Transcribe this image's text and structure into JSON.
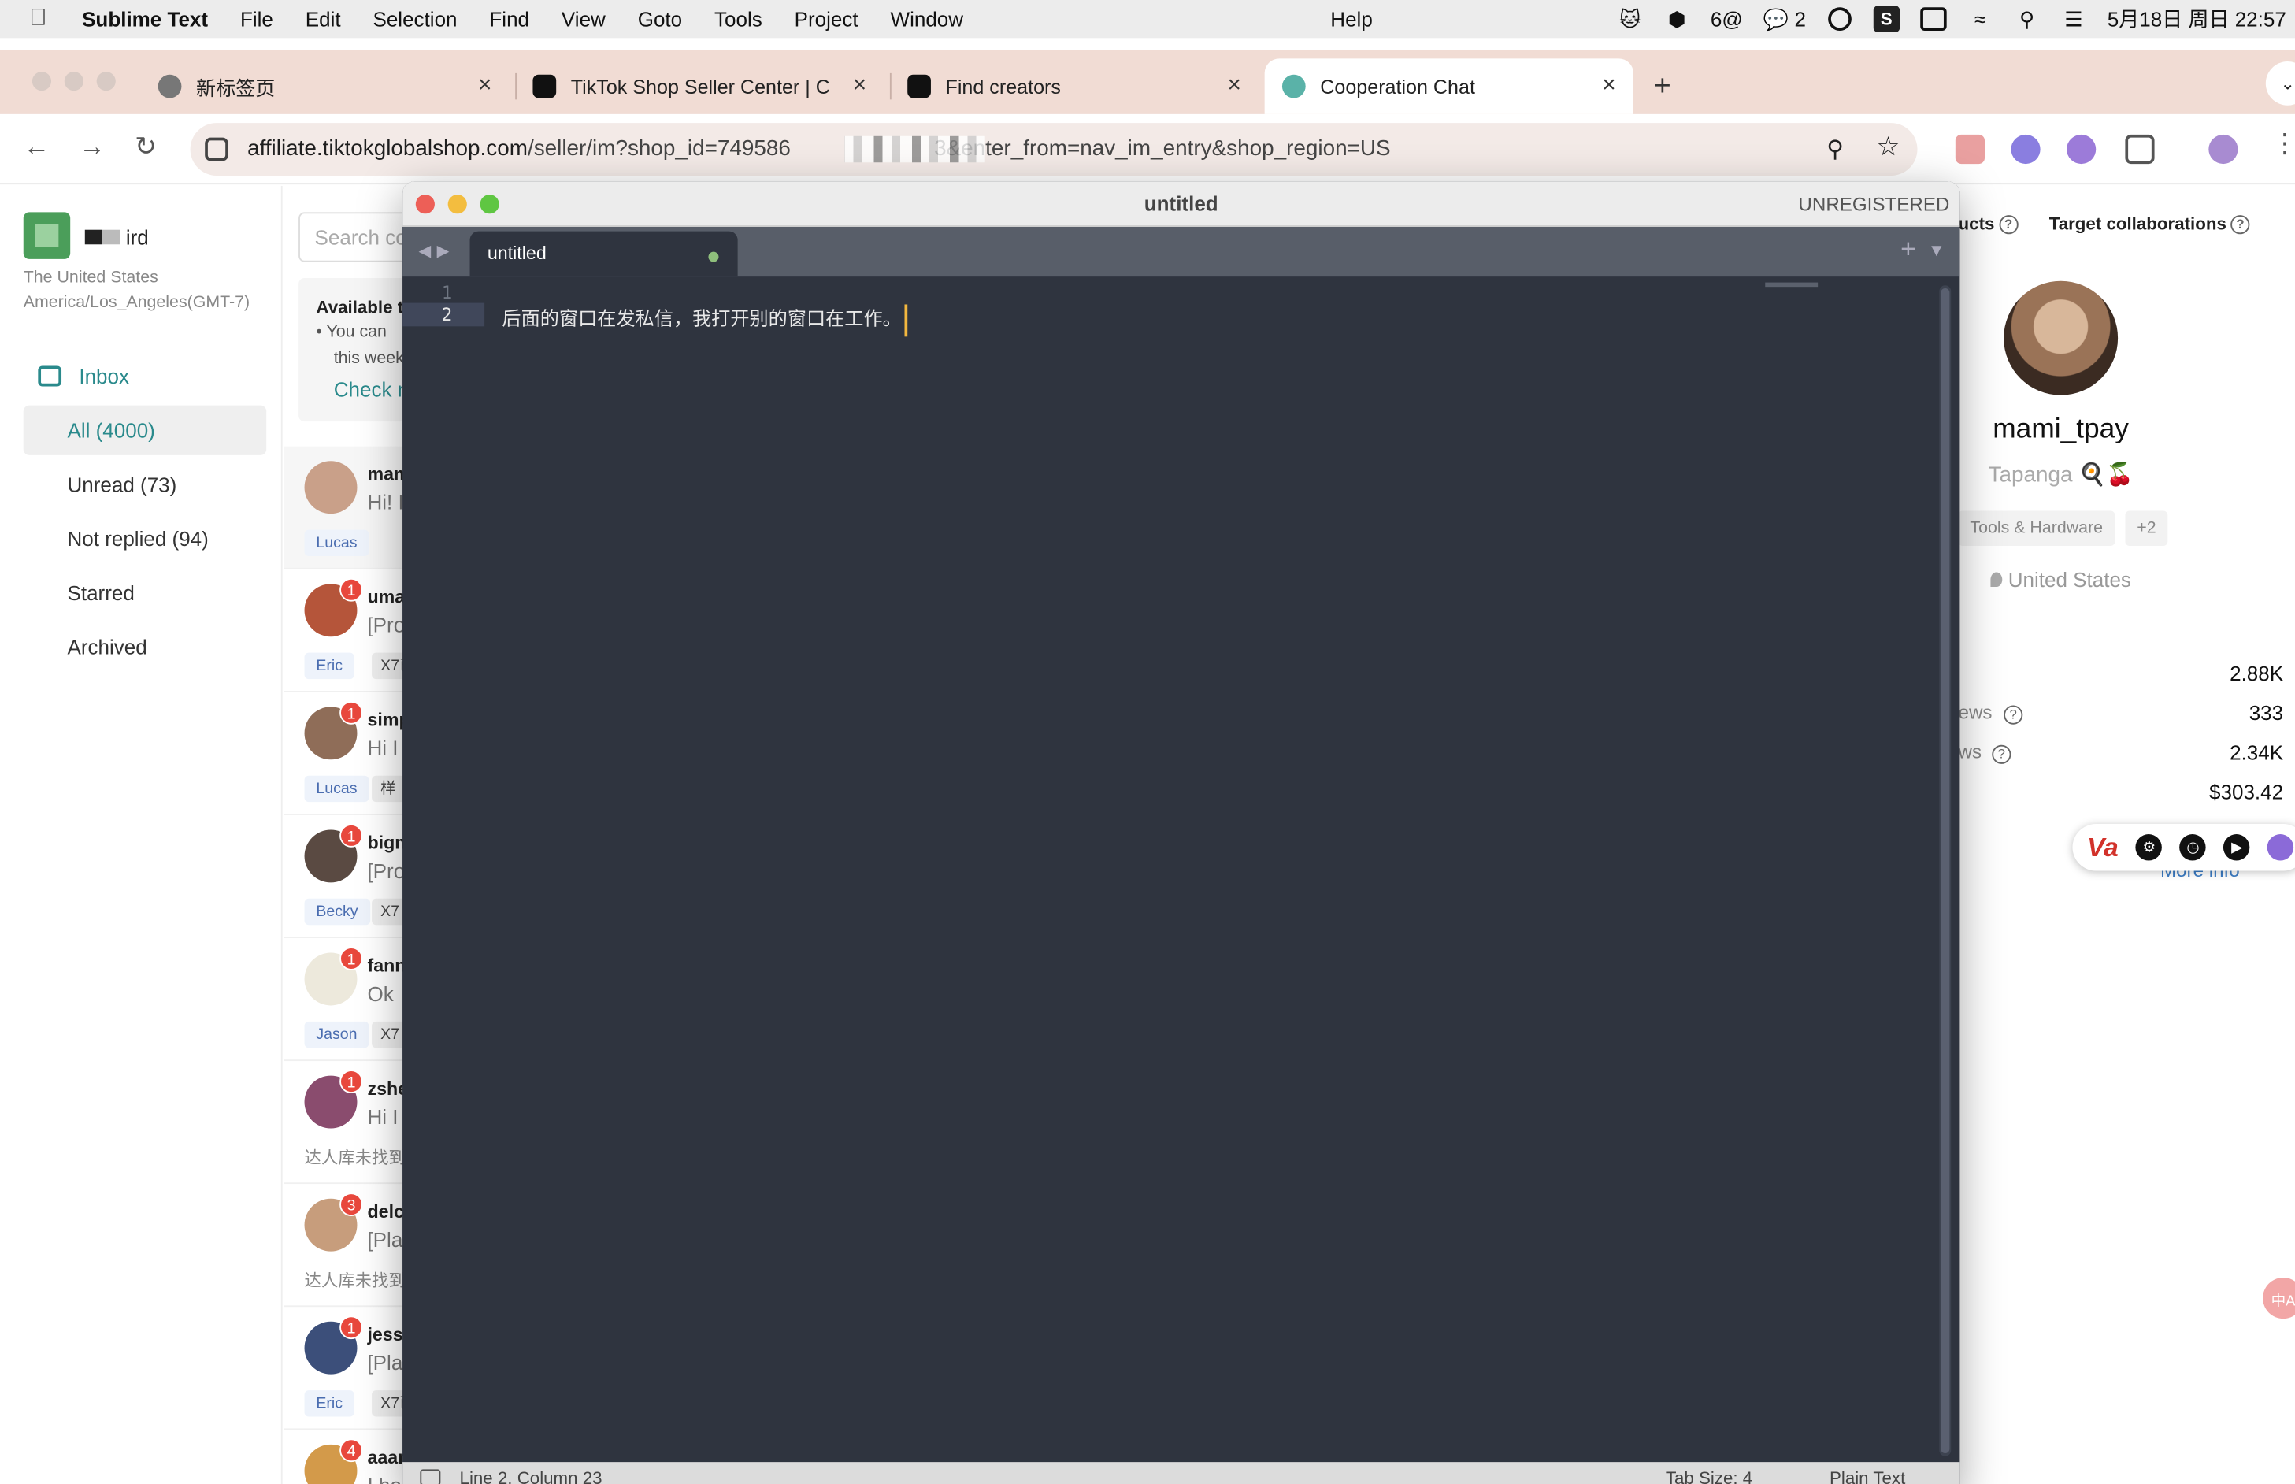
{
  "menubar": {
    "app_name": "Sublime Text",
    "items": [
      "File",
      "Edit",
      "Selection",
      "Find",
      "View",
      "Goto",
      "Tools",
      "Project",
      "Window"
    ],
    "help": "Help",
    "status": {
      "badge_6": "6@",
      "wechat_count": "2",
      "date_time": "5月18日 周日 22:57"
    }
  },
  "browser": {
    "tabs": [
      {
        "title": "新标签页",
        "icon": "chrome-icon"
      },
      {
        "title": "TikTok Shop Seller Center | C",
        "icon": "tiktok-icon"
      },
      {
        "title": "Find creators",
        "icon": "tiktok-icon"
      },
      {
        "title": "Cooperation Chat",
        "icon": "chat-icon"
      }
    ],
    "url_host": "affiliate.tiktokglobalshop.com",
    "url_path_start": "/seller/im?shop_id=749586",
    "url_path_end": "3&enter_from=nav_im_entry&shop_region=US"
  },
  "tiktok": {
    "shop": {
      "name": "ird",
      "country": "The United States",
      "timezone": "America/Los_Angeles(GMT-7)"
    },
    "inbox_label": "Inbox",
    "filters": [
      "All (4000)",
      "Unread (73)",
      "Not replied (94)",
      "Starred",
      "Archived"
    ],
    "search_placeholder": "Search co",
    "notice": {
      "title": "Available t",
      "line1": "You can ",
      "line2": "this week",
      "link": "Check n"
    },
    "conversations": [
      {
        "name": "mam",
        "msg": "Hi! I",
        "badge": "",
        "tag": "Lucas",
        "tag2": "",
        "note": "",
        "color": "#c9a089"
      },
      {
        "name": "uma",
        "msg": "[Pro",
        "badge": "1",
        "tag": "Eric",
        "tag2": "X7已",
        "note": "",
        "color": "#b5553a"
      },
      {
        "name": "simp",
        "msg": "Hi I",
        "badge": "1",
        "tag": "Lucas",
        "tag2": "样",
        "note": "",
        "color": "#8f6d58"
      },
      {
        "name": "bigm",
        "msg": "[Pro",
        "badge": "1",
        "tag": "Becky",
        "tag2": "X7",
        "note": "",
        "color": "#5a4a42"
      },
      {
        "name": "fann",
        "msg": "Ok",
        "badge": "1",
        "tag": "Jason",
        "tag2": "X7",
        "note": "",
        "color": "#ede9dc"
      },
      {
        "name": "zshe",
        "msg": "Hi I",
        "badge": "1",
        "tag": "",
        "tag2": "",
        "note": "达人库未找到",
        "color": "#8a4c6e"
      },
      {
        "name": "delc",
        "msg": "[Pla",
        "badge": "3",
        "tag": "",
        "tag2": "",
        "note": "达人库未找到",
        "color": "#c79d7c"
      },
      {
        "name": "jessi",
        "msg": "[Pla",
        "badge": "1",
        "tag": "Eric",
        "tag2": "X7已",
        "note": "",
        "color": "#3c4f7a"
      },
      {
        "name": "aaar",
        "msg": "I ho",
        "badge": "4",
        "tag": "",
        "tag2": "",
        "note": "",
        "color": "#d39a4a"
      }
    ],
    "right": {
      "tab1": "ucts",
      "tab2": "Target collaborations",
      "creator_name": "mami_tpay",
      "creator_sub": "Tapanga 🍳🍒",
      "chips": [
        "Tools & Hardware",
        "+2"
      ],
      "country": "United States",
      "stats": [
        {
          "label": "",
          "value": "2.88K"
        },
        {
          "label": "ews",
          "value": "333"
        },
        {
          "label": "ws",
          "value": "2.34K"
        },
        {
          "label": "",
          "value": "$303.42"
        }
      ],
      "more_info": "More info",
      "float_va": "Va",
      "side_bubble": "中A"
    }
  },
  "sublime": {
    "window_title": "untitled",
    "unregistered": "UNREGISTERED",
    "tab_name": "untitled",
    "lines": [
      "",
      "后面的窗口在发私信，我打开别的窗口在工作。"
    ],
    "line_numbers": [
      "1",
      "2"
    ],
    "status_position": "Line 2, Column 23",
    "status_tab_size": "Tab Size: 4",
    "status_syntax": "Plain Text"
  }
}
